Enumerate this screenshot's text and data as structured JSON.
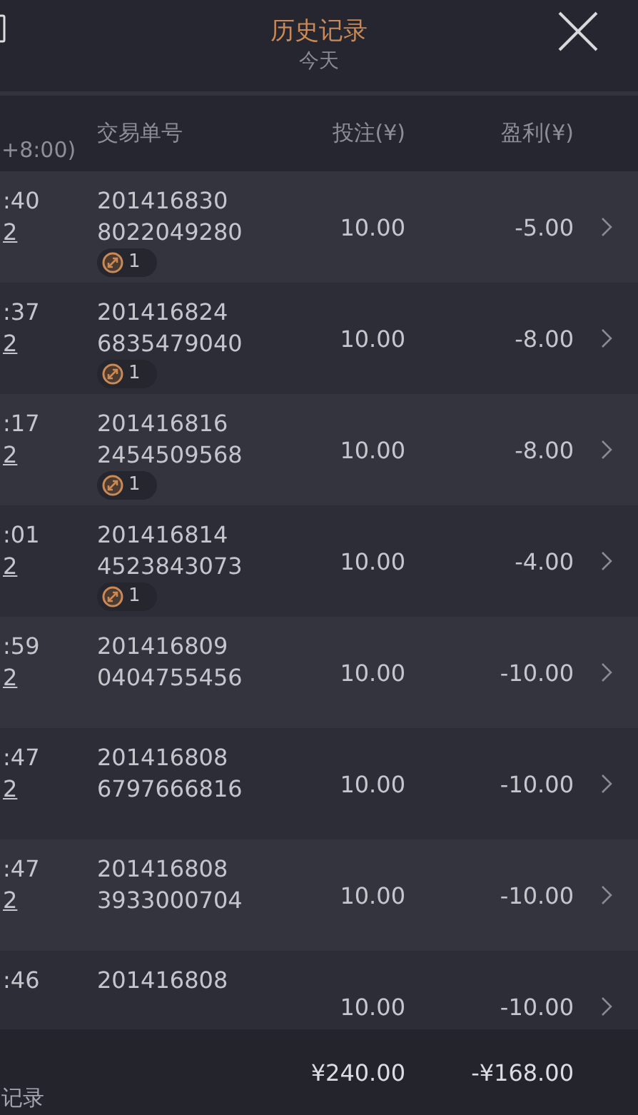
{
  "header": {
    "title": "历史记录",
    "subtitle": "今天"
  },
  "columns": {
    "time": "+8:00)",
    "order": "交易单号",
    "stake": "投注(¥)",
    "profit": "盈利(¥)"
  },
  "rows": [
    {
      "time": ":40",
      "date": "2",
      "order_line1": "201416830",
      "order_line2": "8022049280",
      "badge": "1",
      "stake": "10.00",
      "profit": "-5.00"
    },
    {
      "time": ":37",
      "date": "2",
      "order_line1": "201416824",
      "order_line2": "6835479040",
      "badge": "1",
      "stake": "10.00",
      "profit": "-8.00"
    },
    {
      "time": ":17",
      "date": "2",
      "order_line1": "201416816",
      "order_line2": "2454509568",
      "badge": "1",
      "stake": "10.00",
      "profit": "-8.00"
    },
    {
      "time": ":01",
      "date": "2",
      "order_line1": "201416814",
      "order_line2": "4523843073",
      "badge": "1",
      "stake": "10.00",
      "profit": "-4.00"
    },
    {
      "time": ":59",
      "date": "2",
      "order_line1": "201416809",
      "order_line2": "0404755456",
      "stake": "10.00",
      "profit": "-10.00"
    },
    {
      "time": ":47",
      "date": "2",
      "order_line1": "201416808",
      "order_line2": "6797666816",
      "stake": "10.00",
      "profit": "-10.00"
    },
    {
      "time": ":47",
      "date": "2",
      "order_line1": "201416808",
      "order_line2": "3933000704",
      "stake": "10.00",
      "profit": "-10.00"
    },
    {
      "time": ":46",
      "order_line1": "201416808",
      "stake": "10.00",
      "profit": "-10.00"
    }
  ],
  "footer": {
    "label": "记录",
    "total_stake": "¥240.00",
    "total_profit": "-¥168.00"
  }
}
